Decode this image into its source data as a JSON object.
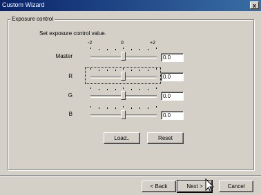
{
  "window": {
    "title": "Custom Wizard",
    "close_label": "x"
  },
  "group": {
    "legend": "Exposure control",
    "instruction": "Set exposure control value.",
    "scale": {
      "min": "-2",
      "mid": "0",
      "max": "+2"
    },
    "rows": [
      {
        "label": "Master",
        "value": "0.0"
      },
      {
        "label": "R",
        "value": "0.0"
      },
      {
        "label": "G",
        "value": "0.0"
      },
      {
        "label": "B",
        "value": "0.0"
      }
    ],
    "load_label": "Load..",
    "reset_label": "Reset"
  },
  "footer": {
    "back_label": "< Back",
    "next_label": "Next >",
    "cancel_label": "Cancel"
  }
}
